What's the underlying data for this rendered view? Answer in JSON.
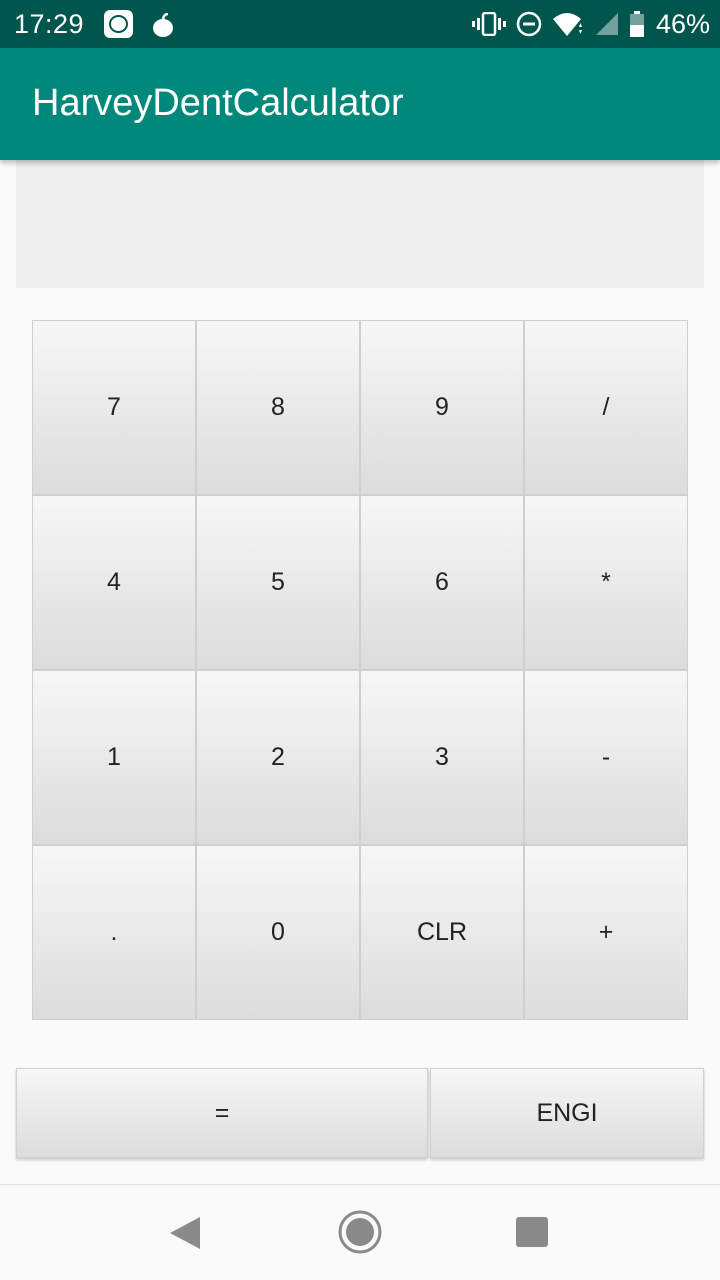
{
  "status_bar": {
    "time": "17:29",
    "battery_percent": "46%",
    "icons": [
      "mi-icon",
      "apple-icon",
      "vibrate-icon",
      "dnd-icon",
      "wifi-icon",
      "signal-icon",
      "battery-icon"
    ],
    "background_color": "#00564d"
  },
  "app_bar": {
    "title": "HarveyDentCalculator",
    "color": "#00897b"
  },
  "display": {
    "value": ""
  },
  "keypad": {
    "keys": [
      {
        "label": "7"
      },
      {
        "label": "8"
      },
      {
        "label": "9"
      },
      {
        "label": "/"
      },
      {
        "label": "4"
      },
      {
        "label": "5"
      },
      {
        "label": "6"
      },
      {
        "label": "*"
      },
      {
        "label": "1"
      },
      {
        "label": "2"
      },
      {
        "label": "3"
      },
      {
        "label": "-"
      },
      {
        "label": "."
      },
      {
        "label": "0"
      },
      {
        "label": "CLR"
      },
      {
        "label": "+"
      }
    ]
  },
  "bottom_row": {
    "equals_label": "=",
    "engi_label": "ENGI"
  },
  "nav_bar": {
    "icons": [
      "back-icon",
      "home-icon",
      "recents-icon"
    ]
  }
}
